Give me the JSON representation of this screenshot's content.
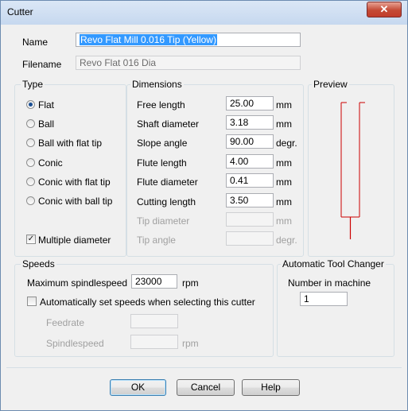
{
  "window": {
    "title": "Cutter",
    "close_glyph": "✕"
  },
  "name": {
    "label": "Name",
    "value": "Revo Flat Mill 0.016 Tip (Yellow)"
  },
  "filename": {
    "label": "Filename",
    "value": "Revo Flat 016 Dia"
  },
  "type": {
    "title": "Type",
    "options": [
      {
        "label": "Flat",
        "selected": true
      },
      {
        "label": "Ball",
        "selected": false
      },
      {
        "label": "Ball with flat tip",
        "selected": false
      },
      {
        "label": "Conic",
        "selected": false
      },
      {
        "label": "Conic with flat tip",
        "selected": false
      },
      {
        "label": "Conic with ball tip",
        "selected": false
      }
    ],
    "multiple_diameter": {
      "label": "Multiple diameter",
      "checked": true,
      "check_glyph": "✓"
    }
  },
  "dimensions": {
    "title": "Dimensions",
    "rows": [
      {
        "label": "Free length",
        "value": "25.00",
        "unit": "mm",
        "enabled": true
      },
      {
        "label": "Shaft diameter",
        "value": "3.18",
        "unit": "mm",
        "enabled": true
      },
      {
        "label": "Slope angle",
        "value": "90.00",
        "unit": "degr.",
        "enabled": true
      },
      {
        "label": "Flute length",
        "value": "4.00",
        "unit": "mm",
        "enabled": true
      },
      {
        "label": "Flute diameter",
        "value": "0.41",
        "unit": "mm",
        "enabled": true
      },
      {
        "label": "Cutting length",
        "value": "3.50",
        "unit": "mm",
        "enabled": true
      },
      {
        "label": "Tip diameter",
        "value": "",
        "unit": "mm",
        "enabled": false
      },
      {
        "label": "Tip angle",
        "value": "",
        "unit": "degr.",
        "enabled": false
      }
    ]
  },
  "preview": {
    "title": "Preview",
    "shank_color": "#cc0000"
  },
  "speeds": {
    "title": "Speeds",
    "max_label": "Maximum spindlespeed",
    "max_value": "23000",
    "max_unit": "rpm",
    "auto_label": "Automatically set speeds when selecting this cutter",
    "auto_checked": false,
    "feedrate_label": "Feedrate",
    "feedrate_value": "",
    "spindlespeed_label": "Spindlespeed",
    "spindlespeed_value": "",
    "spindlespeed_unit": "rpm"
  },
  "atc": {
    "title": "Automatic Tool Changer",
    "number_label": "Number in machine",
    "number_value": "1"
  },
  "buttons": {
    "ok": "OK",
    "cancel": "Cancel",
    "help": "Help"
  }
}
